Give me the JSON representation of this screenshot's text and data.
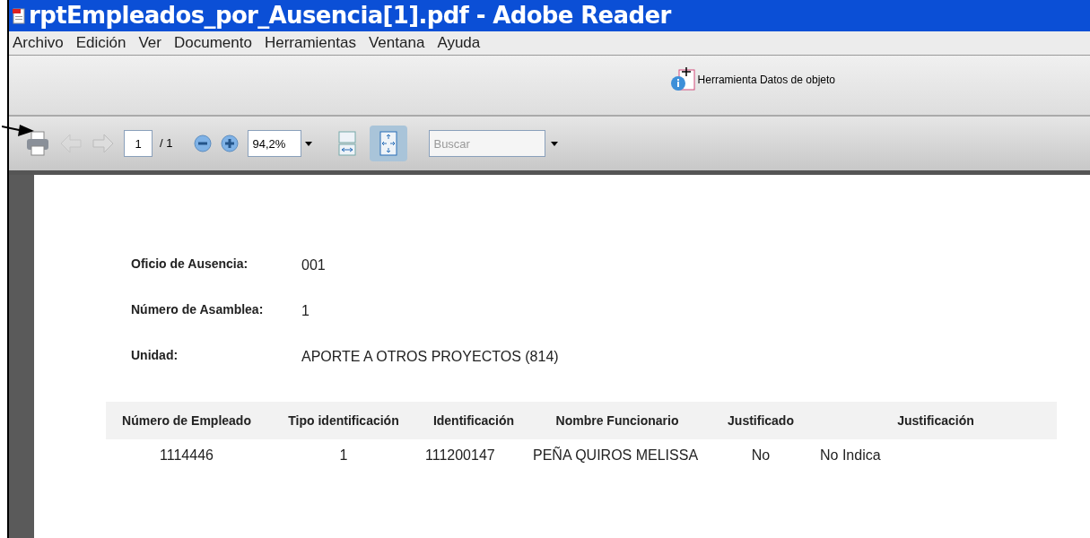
{
  "window": {
    "title": "rptEmpleados_por_Ausencia[1].pdf - Adobe Reader"
  },
  "menu": [
    "Archivo",
    "Edición",
    "Ver",
    "Documento",
    "Herramientas",
    "Ventana",
    "Ayuda"
  ],
  "tools_bar": {
    "button": "Herramienta Datos de objeto"
  },
  "toolbar": {
    "prev_disabled": true,
    "next_disabled": true,
    "page": "1",
    "page_total": "/ 1",
    "zoom": "94,2%",
    "view_buttons": [
      {
        "kind": "fit-width",
        "selected": false
      },
      {
        "kind": "fit-page",
        "selected": true
      }
    ],
    "search": {
      "placeholder": "Buscar"
    }
  },
  "report": {
    "fields": [
      {
        "label": "Oficio de Ausencia:",
        "value": "001"
      },
      {
        "label": "Número de Asamblea:",
        "value": "1"
      },
      {
        "label": "Unidad:",
        "value": "APORTE A OTROS PROYECTOS (814)"
      }
    ],
    "table": {
      "columns": [
        "Número de Empleado",
        "Tipo identificación",
        "Identificación",
        "Nombre Funcionario",
        "Justificado",
        "Justificación"
      ],
      "rows": [
        [
          "1114446",
          "1",
          "111200147",
          "PEÑA QUIROS MELISSA",
          "No",
          "No Indica"
        ]
      ]
    }
  }
}
